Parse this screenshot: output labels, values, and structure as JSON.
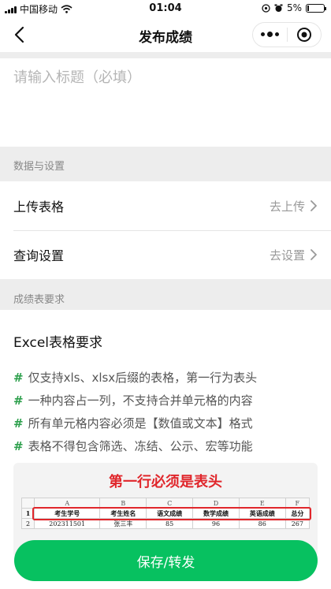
{
  "status_bar": {
    "carrier": "中国移动",
    "time": "01:04",
    "battery": "5%",
    "battery_level": 0.05,
    "icons": [
      "signal-icon",
      "wifi-icon",
      "location-icon",
      "alarm-icon",
      "battery-icon"
    ]
  },
  "nav": {
    "title": "发布成绩",
    "icons": [
      "back-arrow-icon",
      "more-dots-icon",
      "target-icon"
    ]
  },
  "title_input": {
    "placeholder": "请输入标题（必填）",
    "value": ""
  },
  "sections": {
    "data_settings": "数据与设置",
    "requirements": "成绩表要求"
  },
  "settings": {
    "upload": {
      "label": "上传表格",
      "action": "去上传"
    },
    "query": {
      "label": "查询设置",
      "action": "去设置"
    }
  },
  "requirements": {
    "heading": "Excel表格要求",
    "items": [
      "仅支持xls、xlsx后缀的表格，第一行为表头",
      "一种内容占一列，不支持合并单元格的内容",
      "所有单元格内容必须是【数值或文本】格式",
      "表格不得包含筛选、冻结、公示、宏等功能"
    ],
    "bullet": "#"
  },
  "sample": {
    "caption": "第一行必须是表头",
    "columns": [
      "A",
      "B",
      "C",
      "D",
      "E",
      "F"
    ],
    "row_numbers": [
      "1",
      "2"
    ],
    "header": [
      "考生学号",
      "考生姓名",
      "语文成绩",
      "数学成绩",
      "英语成绩",
      "总分"
    ],
    "row": [
      "202311501",
      "张三丰",
      "85",
      "96",
      "86",
      "267"
    ]
  },
  "save_button": "保存/转发",
  "colors": {
    "primary_green": "#07c160",
    "bullet_green": "#2ea04d",
    "caption_red": "#e0262b",
    "background": "#ededed"
  }
}
